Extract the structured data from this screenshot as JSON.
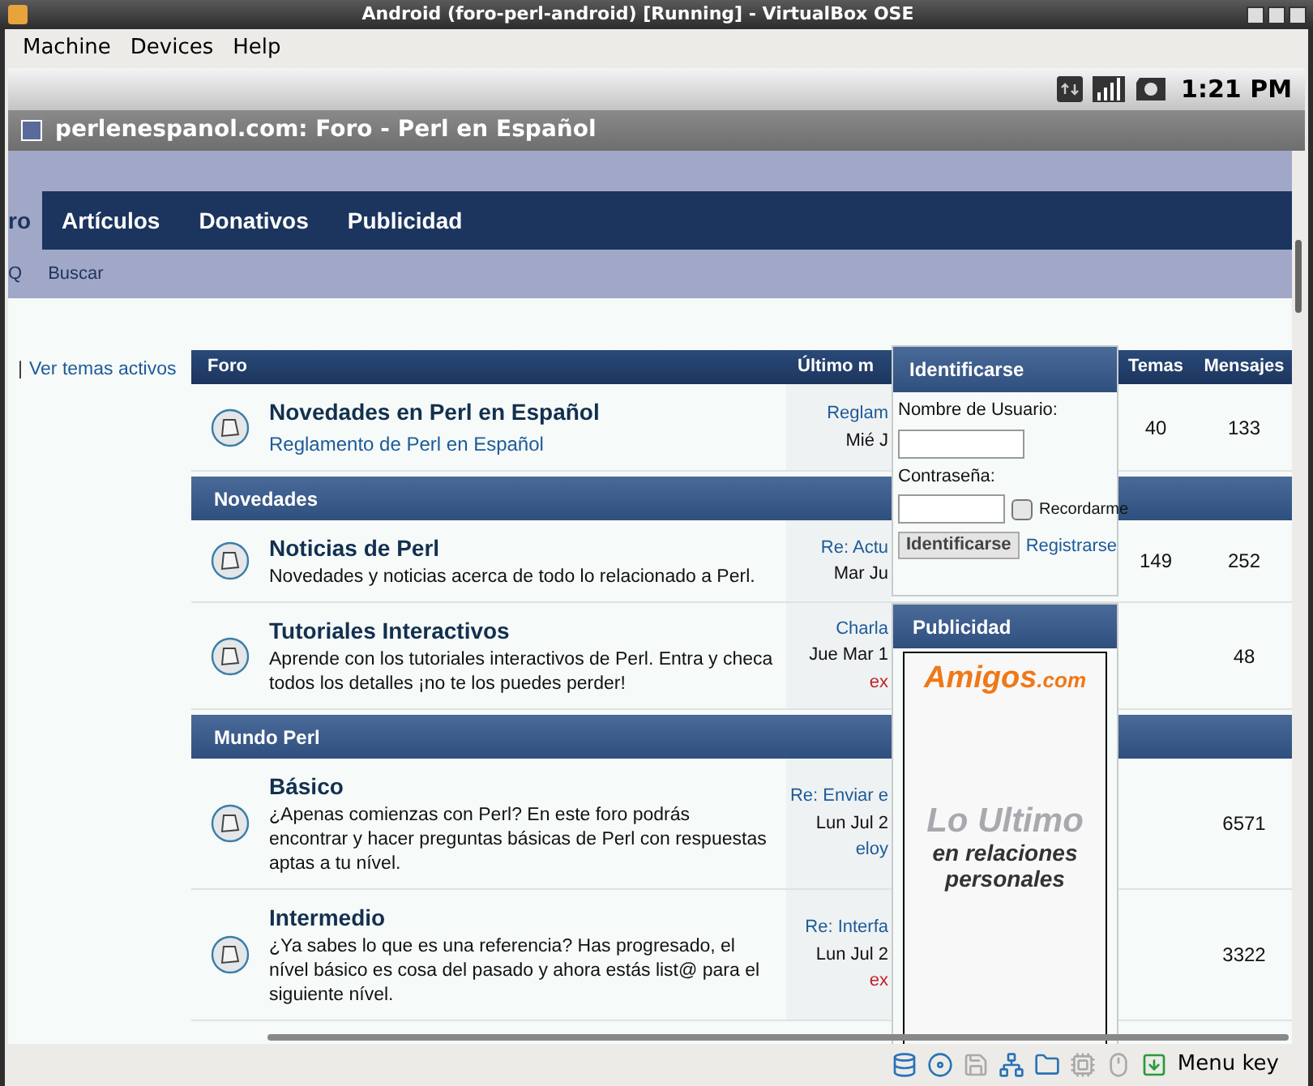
{
  "window": {
    "title": "Android (foro-perl-android) [Running] - VirtualBox OSE"
  },
  "menu": [
    "Machine",
    "Devices",
    "Help"
  ],
  "android_status": {
    "time": "1:21 PM"
  },
  "browser": {
    "title": "perlenespanol.com: Foro - Perl en Español"
  },
  "nav_tabs": [
    {
      "label": "ro",
      "selected": true
    },
    {
      "label": "Artículos",
      "selected": false
    },
    {
      "label": "Donativos",
      "selected": false
    },
    {
      "label": "Publicidad",
      "selected": false
    }
  ],
  "sub_nav": [
    "Q",
    "Buscar"
  ],
  "side_link": {
    "separator": "|",
    "label": "Ver temas activos"
  },
  "table": {
    "columns": [
      "Foro",
      "Último m",
      "Temas",
      "Mensajes"
    ],
    "rows": [
      {
        "kind": "forum",
        "title": "Novedades en Perl en Español",
        "subforum": "Reglamento de Perl en Español",
        "last_post": {
          "topic": "Reglam",
          "date": "Mié J"
        },
        "temas": "40",
        "mensajes": "133"
      },
      {
        "kind": "category",
        "title": "Novedades"
      },
      {
        "kind": "forum",
        "title": "Noticias de Perl",
        "description": "Novedades y noticias acerca de todo lo relacionado a Perl.",
        "last_post": {
          "topic": "Re: Actu",
          "date": "Mar Ju"
        },
        "temas": "149",
        "mensajes": "252"
      },
      {
        "kind": "forum",
        "title": "Tutoriales Interactivos",
        "description": "Aprende con los tutoriales interactivos de Perl. Entra y checa todos los detalles ¡no te los puedes perder!",
        "last_post": {
          "topic": "Charla",
          "date": "Jue Mar 1",
          "author": "ex",
          "color": "#c0202a"
        },
        "mensajes": "48"
      },
      {
        "kind": "category",
        "title": "Mundo Perl"
      },
      {
        "kind": "forum",
        "title": "Básico",
        "description": "¿Apenas comienzas con Perl? En este foro podrás encontrar y hacer preguntas básicas de Perl con respuestas aptas a tu nível.",
        "last_post": {
          "topic": "Re: Enviar e",
          "date": "Lun Jul 2",
          "author": "eloy",
          "color": "#1d5a9a"
        },
        "mensajes": "6571"
      },
      {
        "kind": "forum",
        "title": "Intermedio",
        "description": "¿Ya sabes lo que es una referencia? Has progresado, el nível básico es cosa del pasado y ahora estás list@ para el siguiente nível.",
        "last_post": {
          "topic": "Re: Interfa",
          "date": "Lun Jul 2",
          "author": "ex",
          "color": "#c0202a"
        },
        "mensajes": "3322"
      }
    ]
  },
  "login": {
    "title": "Identificarse",
    "username_label": "Nombre de Usuario:",
    "password_label": "Contraseña:",
    "remember": {
      "label": "Recordarme",
      "checked": false
    },
    "submit": "Identificarse",
    "register": "Registrarse"
  },
  "ad_panel": {
    "title": "Publicidad",
    "brand": "Amigos",
    "brand_suffix": ".com",
    "lines": [
      "Lo Ultimo",
      "en relaciones",
      "personales"
    ]
  },
  "status_bar": {
    "menu_key": "Menu key"
  }
}
